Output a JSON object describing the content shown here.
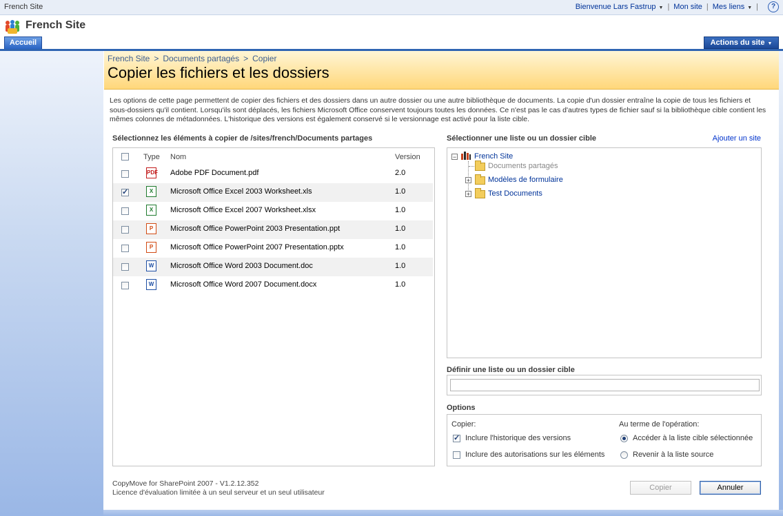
{
  "global": {
    "site_name": "French Site",
    "welcome": "Bienvenue Lars Fastrup",
    "my_site": "Mon site",
    "my_links": "Mes liens",
    "help": "?"
  },
  "header": {
    "site_title": "French Site"
  },
  "tabs": {
    "home": "Accueil",
    "site_actions": "Actions du site"
  },
  "breadcrumb": {
    "items": [
      "French Site",
      "Documents partagés",
      "Copier"
    ],
    "separator": ">"
  },
  "page": {
    "title": "Copier les fichiers et les dossiers",
    "description": "Les options de cette page permettent de copier des fichiers et des dossiers dans un autre dossier ou une autre bibliothèque de documents. La copie d'un dossier entraîne la copie de tous les fichiers et sous-dossiers qu'il contient. Lorsqu'ils sont déplacés, les fichiers Microsoft Office conservent toujours toutes les données. Ce n'est pas le cas d'autres types de fichier sauf si la bibliothèque cible contient les mêmes colonnes de métadonnées. L'historique des versions est également conservé si le versionnage est activé pour la liste cible."
  },
  "source": {
    "title": "Sélectionnez les éléments à copier de /sites/french/Documents partages",
    "columns": {
      "type": "Type",
      "name": "Nom",
      "version": "Version"
    },
    "files": [
      {
        "name": "Adobe PDF Document.pdf",
        "version": "2.0",
        "icon": "pdf",
        "icon_label": "PDF",
        "checked": false
      },
      {
        "name": "Microsoft Office Excel 2003 Worksheet.xls",
        "version": "1.0",
        "icon": "xls",
        "icon_label": "X",
        "checked": true
      },
      {
        "name": "Microsoft Office Excel 2007 Worksheet.xlsx",
        "version": "1.0",
        "icon": "xls",
        "icon_label": "X",
        "checked": false
      },
      {
        "name": "Microsoft Office PowerPoint 2003 Presentation.ppt",
        "version": "1.0",
        "icon": "ppt",
        "icon_label": "P",
        "checked": false
      },
      {
        "name": "Microsoft Office PowerPoint 2007 Presentation.pptx",
        "version": "1.0",
        "icon": "ppt",
        "icon_label": "P",
        "checked": false
      },
      {
        "name": "Microsoft Office Word 2003 Document.doc",
        "version": "1.0",
        "icon": "doc",
        "icon_label": "W",
        "checked": false
      },
      {
        "name": "Microsoft Office Word 2007 Document.docx",
        "version": "1.0",
        "icon": "doc",
        "icon_label": "W",
        "checked": false
      }
    ]
  },
  "target": {
    "title": "Sélectionner une liste ou un dossier cible",
    "add_site": "Ajouter un site",
    "tree": {
      "root": "French Site",
      "children": [
        {
          "label": "Documents partagés",
          "disabled": true,
          "expandable": false
        },
        {
          "label": "Modèles de formulaire",
          "disabled": false,
          "expandable": true
        },
        {
          "label": "Test Documents",
          "disabled": false,
          "expandable": true
        }
      ]
    },
    "define_title": "Définir une liste ou un dossier cible",
    "define_value": ""
  },
  "options": {
    "title": "Options",
    "copy_label": "Copier:",
    "include_history": "Inclure l'historique des versions",
    "include_history_checked": true,
    "include_permissions": "Inclure des autorisations sur les éléments",
    "include_permissions_checked": false,
    "after_label": "Au terme de l'opération:",
    "go_to_target": "Accéder à la liste cible sélectionnée",
    "return_source": "Revenir à la liste source",
    "after_selected": "go_to_target"
  },
  "footer": {
    "product": "CopyMove for SharePoint 2007 - V1.2.12.352",
    "license": "Licence d'évaluation limitée à un seul serveur et un seul utilisateur",
    "copy_button": "Copier",
    "cancel_button": "Annuler"
  }
}
